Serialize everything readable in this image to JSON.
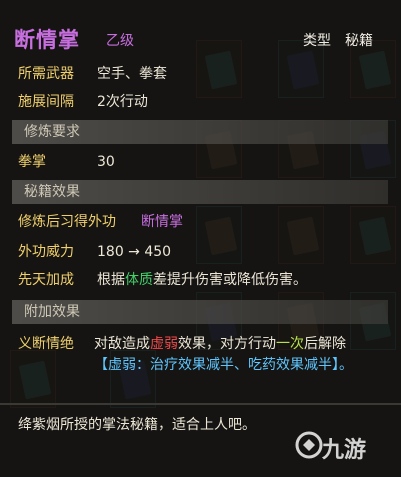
{
  "skill": {
    "name": "断情掌",
    "grade": "乙级",
    "type_label": "类型",
    "type_value": "秘籍"
  },
  "attributes": [
    {
      "label": "所需武器",
      "value": "空手、拳套"
    },
    {
      "label": "施展间隔",
      "value": "2次行动"
    }
  ],
  "training": {
    "header": "修炼要求",
    "label": "拳掌",
    "value": "30"
  },
  "secret": {
    "header": "秘籍效果",
    "learn_label": "修炼后习得外功",
    "learn_value": "断情掌",
    "power_label": "外功威力",
    "power_value": "180 → 450",
    "innate_label": "先天加成",
    "innate_pre": "根据",
    "innate_highlight": "体质",
    "innate_post": "差提升伤害或降低伤害。"
  },
  "extra": {
    "header": "附加效果",
    "label": "义断情绝",
    "e1": "对敌造成",
    "e2": "虚弱",
    "e3": "效果，对方行动",
    "e4": "一次",
    "e5": "后解除",
    "e6": "【虚弱：治疗效果减半、吃药效果减半】。"
  },
  "description": "绛紫烟所授的掌法秘籍，适合上人吧。",
  "watermark": "九游",
  "colors": {
    "purple": "#c86fe0",
    "gold": "#f0d06c",
    "green": "#42d06a",
    "red": "#ee4a4a",
    "cyan": "#5fc6ff"
  }
}
